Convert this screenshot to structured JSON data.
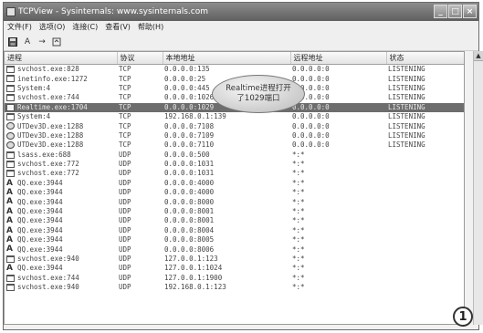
{
  "window": {
    "title": "TCPView - Sysinternals: www.sysinternals.com"
  },
  "menu": [
    "文件(F)",
    "选项(O)",
    "连接(C)",
    "查看(V)",
    "帮助(H)"
  ],
  "toolbar": {
    "save_icon": "floppy-icon",
    "a_label": "A",
    "arrow": "→",
    "refresh_icon": "refresh-icon"
  },
  "columns": [
    "进程",
    "协议",
    "本地地址",
    "远程地址",
    "状态"
  ],
  "rows": [
    {
      "icon": "win",
      "proc": "svchost.exe:828",
      "proto": "TCP",
      "local": "0.0.0.0:135",
      "remote": "0.0.0.0:0",
      "state": "LISTENING"
    },
    {
      "icon": "win",
      "proc": "inetinfo.exe:1272",
      "proto": "TCP",
      "local": "0.0.0.0:25",
      "remote": "0.0.0.0:0",
      "state": "LISTENING"
    },
    {
      "icon": "win",
      "proc": "System:4",
      "proto": "TCP",
      "local": "0.0.0.0:445",
      "remote": "0.0.0.0:0",
      "state": "LISTENING"
    },
    {
      "icon": "win",
      "proc": "svchost.exe:744",
      "proto": "TCP",
      "local": "0.0.0.0:1026",
      "remote": "0.0.0.0:0",
      "state": "LISTENING"
    },
    {
      "icon": "doc",
      "proc": "Realtime.exe:1704",
      "proto": "TCP",
      "local": "0.0.0.0:1029",
      "remote": "0.0.0.0:0",
      "state": "LISTENING",
      "selected": true
    },
    {
      "icon": "win",
      "proc": "System:4",
      "proto": "TCP",
      "local": "192.168.0.1:139",
      "remote": "0.0.0.0:0",
      "state": "LISTENING"
    },
    {
      "icon": "net",
      "proc": "UTDev3D.exe:1288",
      "proto": "TCP",
      "local": "0.0.0.0:7108",
      "remote": "0.0.0.0:0",
      "state": "LISTENING"
    },
    {
      "icon": "net",
      "proc": "UTDev3D.exe:1288",
      "proto": "TCP",
      "local": "0.0.0.0:7109",
      "remote": "0.0.0.0:0",
      "state": "LISTENING"
    },
    {
      "icon": "net",
      "proc": "UTDev3D.exe:1288",
      "proto": "TCP",
      "local": "0.0.0.0:7110",
      "remote": "0.0.0.0:0",
      "state": "LISTENING"
    },
    {
      "icon": "win",
      "proc": "lsass.exe:688",
      "proto": "UDP",
      "local": "0.0.0.0:500",
      "remote": "*:*",
      "state": ""
    },
    {
      "icon": "win",
      "proc": "svchost.exe:772",
      "proto": "UDP",
      "local": "0.0.0.0:1031",
      "remote": "*:*",
      "state": ""
    },
    {
      "icon": "win",
      "proc": "svchost.exe:772",
      "proto": "UDP",
      "local": "0.0.0.0:1031",
      "remote": "*:*",
      "state": ""
    },
    {
      "icon": "qq",
      "proc": "QQ.exe:3944",
      "proto": "UDP",
      "local": "0.0.0.0:4000",
      "remote": "*:*",
      "state": ""
    },
    {
      "icon": "qq",
      "proc": "QQ.exe:3944",
      "proto": "UDP",
      "local": "0.0.0.0:4000",
      "remote": "*:*",
      "state": ""
    },
    {
      "icon": "qq",
      "proc": "QQ.exe:3944",
      "proto": "UDP",
      "local": "0.0.0.0:8000",
      "remote": "*:*",
      "state": ""
    },
    {
      "icon": "qq",
      "proc": "QQ.exe:3944",
      "proto": "UDP",
      "local": "0.0.0.0:8001",
      "remote": "*:*",
      "state": ""
    },
    {
      "icon": "qq",
      "proc": "QQ.exe:3944",
      "proto": "UDP",
      "local": "0.0.0.0:8001",
      "remote": "*:*",
      "state": ""
    },
    {
      "icon": "qq",
      "proc": "QQ.exe:3944",
      "proto": "UDP",
      "local": "0.0.0.0:8004",
      "remote": "*:*",
      "state": ""
    },
    {
      "icon": "qq",
      "proc": "QQ.exe:3944",
      "proto": "UDP",
      "local": "0.0.0.0:8005",
      "remote": "*:*",
      "state": ""
    },
    {
      "icon": "qq",
      "proc": "QQ.exe:3944",
      "proto": "UDP",
      "local": "0.0.0.0:8006",
      "remote": "*:*",
      "state": ""
    },
    {
      "icon": "win",
      "proc": "svchost.exe:940",
      "proto": "UDP",
      "local": "127.0.0.1:123",
      "remote": "*:*",
      "state": ""
    },
    {
      "icon": "qq",
      "proc": "QQ.exe:3944",
      "proto": "UDP",
      "local": "127.0.0.1:1024",
      "remote": "*:*",
      "state": ""
    },
    {
      "icon": "win",
      "proc": "svchost.exe:744",
      "proto": "UDP",
      "local": "127.0.0.1:1900",
      "remote": "*:*",
      "state": ""
    },
    {
      "icon": "win",
      "proc": "svchost.exe:940",
      "proto": "UDP",
      "local": "192.168.0.1:123",
      "remote": "*:*",
      "state": ""
    }
  ],
  "callout": {
    "text": "Realtime进程打开\n了1029端口"
  },
  "badge": {
    "label": "1"
  }
}
